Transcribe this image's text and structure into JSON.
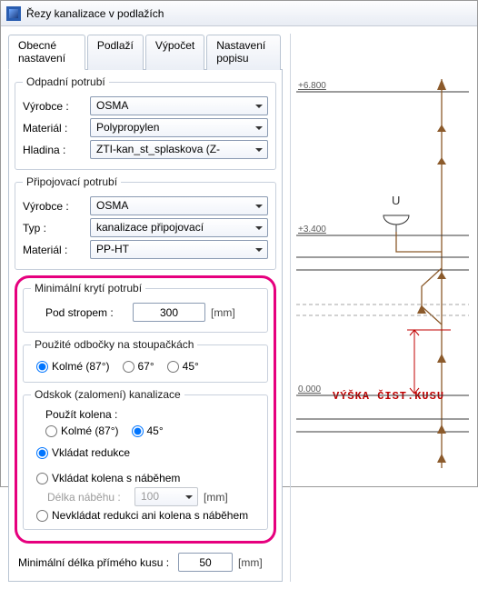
{
  "window": {
    "title": "Řezy kanalizace v podlažích"
  },
  "tabs": {
    "general": "Obecné nastavení",
    "floors": "Podlaží",
    "calc": "Výpočet",
    "desc_settings": "Nastavení popisu"
  },
  "waste": {
    "legend": "Odpadní potrubí",
    "manufacturer_lbl": "Výrobce :",
    "manufacturer": "OSMA",
    "material_lbl": "Materiál :",
    "material": "Polypropylen",
    "layer_lbl": "Hladina :",
    "layer": "ZTI-kan_st_splaskova  (Z-"
  },
  "connect": {
    "legend": "Připojovací potrubí",
    "manufacturer_lbl": "Výrobce :",
    "manufacturer": "OSMA",
    "type_lbl": "Typ :",
    "type": "kanalizace připojovací",
    "material_lbl": "Materiál :",
    "material": "PP-HT"
  },
  "cover": {
    "legend": "Minimální krytí potrubí",
    "under_ceiling_lbl": "Pod stropem :",
    "under_ceiling_val": "300",
    "unit": "[mm]"
  },
  "branches": {
    "legend": "Použité odbočky na stoupačkách",
    "opt1": "Kolmé (87°)",
    "opt2": "67°",
    "opt3": "45°"
  },
  "offset": {
    "legend": "Odskok (zalomení) kanalizace",
    "sub_lbl": "Použít kolena :",
    "opt1": "Kolmé (87°)",
    "opt2": "45°",
    "radio_reduce": "Vkládat redukce",
    "radio_bends": "Vkládat kolena s náběhem",
    "runin_lbl": "Délka náběhu :",
    "runin_val": "100",
    "runin_unit": "[mm]",
    "radio_none": "Nevkládat redukci ani kolena s náběhem"
  },
  "bottom": {
    "lbl": "Minimální délka přímého kusu :",
    "val": "50",
    "unit": "[mm]"
  },
  "diagram": {
    "top_level": "+6.800",
    "mid_level": "+3.400",
    "ground_level": "0.000",
    "annotation": "VÝŠKA ČIST.KUSU",
    "fixture": "U"
  }
}
